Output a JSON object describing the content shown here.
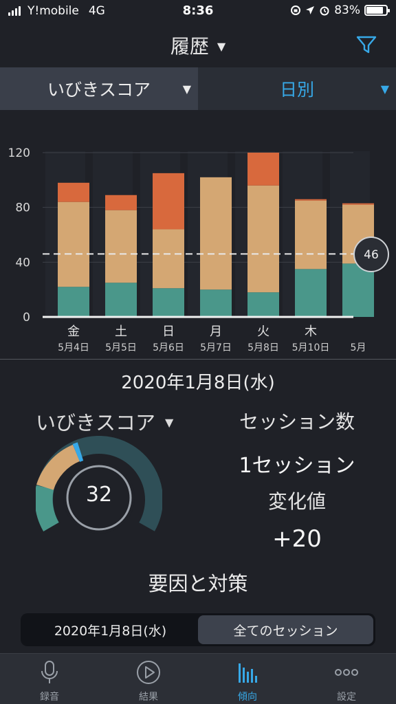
{
  "status_bar": {
    "carrier": "Y!mobile",
    "network": "4G",
    "time": "8:36",
    "battery": "83%"
  },
  "header": {
    "title": "履歴",
    "filter_icon": "filter-icon"
  },
  "selectors": {
    "metric": "いびきスコア",
    "period": "日別"
  },
  "chart_data": {
    "type": "bar",
    "stacked": true,
    "y_ticks": [
      "120",
      "80",
      "40",
      "0"
    ],
    "ylim": [
      0,
      120
    ],
    "average": 46,
    "average_label": "46",
    "categories": [
      {
        "day": "金",
        "date": "5月4日"
      },
      {
        "day": "土",
        "date": "5月5日"
      },
      {
        "day": "日",
        "date": "5月6日"
      },
      {
        "day": "月",
        "date": "5月7日"
      },
      {
        "day": "火",
        "date": "5月8日"
      },
      {
        "day": "木",
        "date": "5月10日"
      },
      {
        "day": "",
        "date": "5月"
      }
    ],
    "series": [
      {
        "color": "#4a978a",
        "values": [
          22,
          25,
          21,
          20,
          18,
          35,
          39
        ]
      },
      {
        "color": "#d4a773",
        "values": [
          62,
          53,
          43,
          82,
          78,
          50,
          43
        ]
      },
      {
        "color": "#d8693d",
        "values": [
          14,
          11,
          41,
          0,
          24,
          1,
          1
        ]
      }
    ]
  },
  "summary": {
    "date": "2020年1月8日(水)",
    "metric_label": "いびきスコア",
    "score": "32",
    "sessions_label": "セッション数",
    "sessions_value": "1セッション",
    "change_label": "変化値",
    "change_value": "+20",
    "factors_label": "要因と対策"
  },
  "segment": {
    "option1": "2020年1月8日(水)",
    "option2": "全てのセッション"
  },
  "tabs": [
    {
      "label": "録音",
      "icon": "microphone-icon"
    },
    {
      "label": "結果",
      "icon": "play-icon"
    },
    {
      "label": "傾向",
      "icon": "bar-chart-icon"
    },
    {
      "label": "設定",
      "icon": "more-icon"
    }
  ],
  "colors": {
    "accent": "#37a9e8",
    "teal": "#4a978a",
    "tan": "#d4a773",
    "orange": "#d8693d"
  }
}
